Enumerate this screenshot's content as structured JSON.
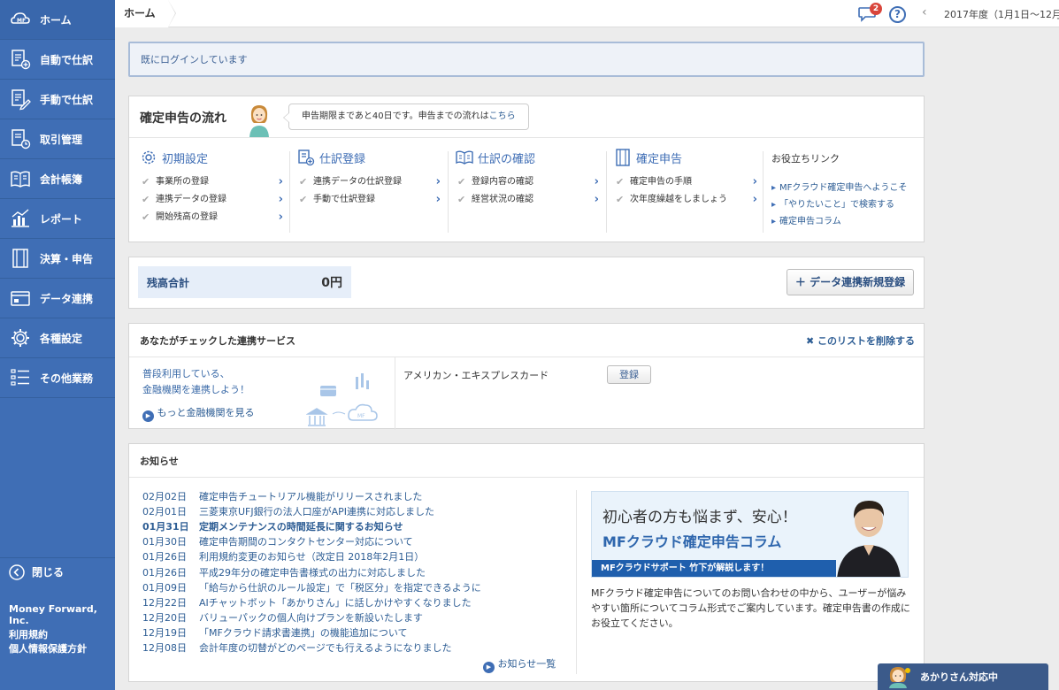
{
  "sidebar": {
    "logo_text": "MF",
    "items": [
      {
        "label": "ホーム",
        "icon": "cloud-logo-icon"
      },
      {
        "label": "自動で仕訳",
        "icon": "auto-journal-icon"
      },
      {
        "label": "手動で仕訳",
        "icon": "manual-journal-icon"
      },
      {
        "label": "取引管理",
        "icon": "transaction-icon"
      },
      {
        "label": "会計帳簿",
        "icon": "book-icon"
      },
      {
        "label": "レポート",
        "icon": "report-icon"
      },
      {
        "label": "決算・申告",
        "icon": "settlement-icon"
      },
      {
        "label": "データ連携",
        "icon": "data-link-icon"
      },
      {
        "label": "各種設定",
        "icon": "gear-icon"
      },
      {
        "label": "その他業務",
        "icon": "list-icon"
      }
    ],
    "close_label": "閉じる",
    "company": "Money Forward, Inc.",
    "terms": "利用規約",
    "privacy": "個人情報保護方針"
  },
  "topbar": {
    "breadcrumb": "ホーム",
    "notification_count": "2",
    "help": "?",
    "fiscal_year": "2017年度（1月1日〜12月"
  },
  "login_message": "既にログインしています",
  "flow": {
    "title": "確定申告の流れ",
    "bubble_text": "申告期限まであと40日です。申告までの流れは",
    "bubble_link": "こちら",
    "steps": [
      {
        "title": "初期設定",
        "icon": "gear-icon",
        "items": [
          "事業所の登録",
          "連携データの登録",
          "開始残高の登録"
        ]
      },
      {
        "title": "仕訳登録",
        "icon": "journal-add-icon",
        "items": [
          "連携データの仕訳登録",
          "手動で仕訳登録"
        ]
      },
      {
        "title": "仕訳の確認",
        "icon": "open-book-icon",
        "items": [
          "登録内容の確認",
          "経営状況の確認"
        ]
      },
      {
        "title": "確定申告",
        "icon": "document-icon",
        "items": [
          "確定申告の手順",
          "次年度繰越をしましょう"
        ]
      }
    ],
    "useful_title": "お役立ちリンク",
    "useful_links": [
      "MFクラウド確定申告へようこそ",
      "「やりたいこと」で検索する",
      "確定申告コラム"
    ]
  },
  "balance": {
    "label": "残高合計",
    "value": "0円",
    "add_button": "データ連携新規登録"
  },
  "services": {
    "title": "あなたがチェックした連携サービス",
    "remove": "このリストを削除する",
    "promo_line1": "普段利用している、",
    "promo_line2": "金融機関を連携しよう！",
    "see_more": "もっと金融機関を見る",
    "service_name": "アメリカン・エキスプレスカード",
    "register": "登録"
  },
  "news": {
    "title": "お知らせ",
    "items": [
      {
        "date": "02月02日",
        "text": "確定申告チュートリアル機能がリリースされました",
        "bold": false
      },
      {
        "date": "02月01日",
        "text": "三菱東京UFJ銀行の法人口座がAPI連携に対応しました",
        "bold": false
      },
      {
        "date": "01月31日",
        "text": "定期メンテナンスの時間延長に関するお知らせ",
        "bold": true
      },
      {
        "date": "01月30日",
        "text": "確定申告期間のコンタクトセンター対応について",
        "bold": false
      },
      {
        "date": "01月26日",
        "text": "利用規約変更のお知らせ（改定日 2018年2月1日）",
        "bold": false
      },
      {
        "date": "01月26日",
        "text": "平成29年分の確定申告書様式の出力に対応しました",
        "bold": false
      },
      {
        "date": "01月09日",
        "text": "「給与から仕訳のルール設定」で「税区分」を指定できるように",
        "bold": false
      },
      {
        "date": "12月22日",
        "text": "AIチャットボット「あかりさん」に話しかけやすくなりました",
        "bold": false
      },
      {
        "date": "12月20日",
        "text": "バリューパックの個人向けプランを新設いたします",
        "bold": false
      },
      {
        "date": "12月19日",
        "text": "「MFクラウド請求書連携」の機能追加について",
        "bold": false
      },
      {
        "date": "12月08日",
        "text": "会計年度の切替がどのページでも行えるようになりました",
        "bold": false
      }
    ],
    "more": "お知らせ一覧",
    "banner_line1": "初心者の方も悩まず、安心！",
    "banner_line2": "MFクラウド確定申告コラム",
    "banner_bar": "MFクラウドサポート 竹下が解説します！",
    "banner_desc": "MFクラウド確定申告についてのお問い合わせの中から、ユーザーが悩みやすい箇所についてコラム形式でご案内しています。確定申告書の作成にお役立てください。"
  },
  "akari": {
    "label": "あかりさん対応中"
  },
  "colors": {
    "sidebar": "#3f6eb5",
    "accent": "#3f6eb5",
    "link": "#2d5d94",
    "badge": "#d9453b"
  }
}
